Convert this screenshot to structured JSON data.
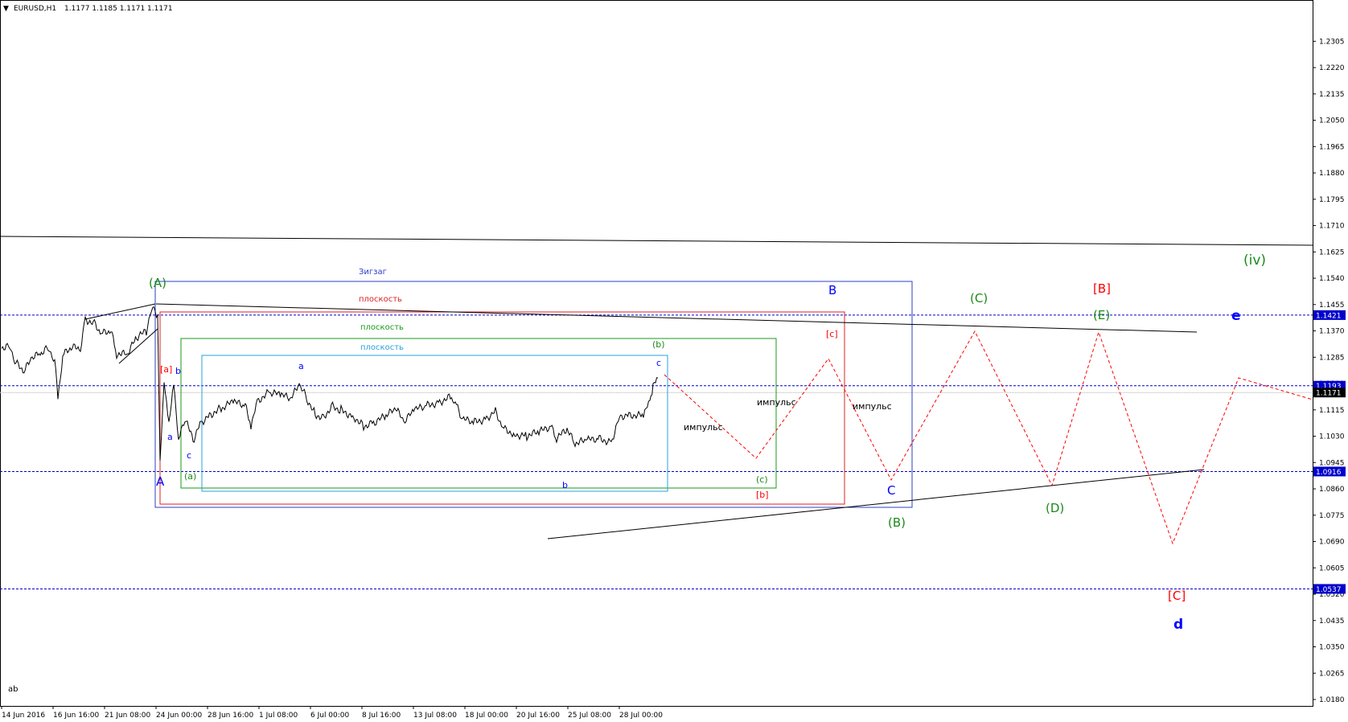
{
  "header": {
    "symbol": "EURUSD,H1",
    "ohlc": "1.1177 1.1185 1.1171 1.1171",
    "footer_text": "ab"
  },
  "chart_data": {
    "type": "line",
    "title": "EURUSD,H1  1.1177 1.1185 1.1171 1.1171",
    "ylim": [
      1.018,
      1.235
    ],
    "grid": false,
    "y_ticks": [
      "1.2305",
      "1.2220",
      "1.2135",
      "1.2050",
      "1.1965",
      "1.1880",
      "1.1795",
      "1.1710",
      "1.1625",
      "1.1540",
      "1.1455",
      "1.1370",
      "1.1285",
      "1.1200",
      "1.1115",
      "1.1030",
      "1.0945",
      "1.0860",
      "1.0775",
      "1.0690",
      "1.0605",
      "1.0520",
      "1.0435",
      "1.0350",
      "1.0265",
      "1.0180"
    ],
    "x_ticks": [
      "14 Jun 2016",
      "16 Jun 16:00",
      "21 Jun 08:00",
      "24 Jun 00:00",
      "28 Jun 16:00",
      "1 Jul 08:00",
      "6 Jul 00:00",
      "8 Jul 16:00",
      "13 Jul 08:00",
      "18 Jul 00:00",
      "20 Jul 16:00",
      "25 Jul 08:00",
      "28 Jul 00:00"
    ],
    "price_lines": [
      {
        "value": 1.1421,
        "label": "1.1421",
        "style": "dotted",
        "color": "#0000cc"
      },
      {
        "value": 1.1193,
        "label": "1.1193",
        "style": "dotted",
        "color": "#0000cc"
      },
      {
        "value": 1.0916,
        "label": "1.0916",
        "style": "dotted",
        "color": "#0000cc"
      },
      {
        "value": 1.0537,
        "label": "1.0537",
        "style": "dotted",
        "color": "#0000cc"
      },
      {
        "value": 1.1171,
        "label": "1.1171",
        "style": "solid-gray",
        "color": "#aaaaaa"
      }
    ],
    "boxes": [
      {
        "name": "Зигзаг",
        "color": "#2b3fc9"
      },
      {
        "name": "плоскость",
        "color": "#e02020"
      },
      {
        "name": "плоскость",
        "color": "#1a9a1a"
      },
      {
        "name": "плоскость",
        "color": "#2aa0e0"
      }
    ],
    "series": [
      {
        "color": "#000000",
        "style": "solid"
      },
      {
        "color": "#ff0000",
        "style": "dashed"
      }
    ]
  },
  "labels": {
    "box_zigzag": "Зигзаг",
    "box_flat_red": "плоскость",
    "box_flat_green": "плоскость",
    "box_flat_cyan": "плоскость",
    "A_green": "(A)",
    "A_blue": "A",
    "a_red": "[a]",
    "b_blue_small": "b",
    "a_blue_small": "a",
    "c_blue_small": "c",
    "a_green_small": "(a)",
    "a_top": "a",
    "b_bottom": "b",
    "c_top": "c",
    "b_green": "(b)",
    "c_green": "(c)",
    "b_red": "[b]",
    "c_red": "[c]",
    "B_blue": "B",
    "C_blue": "C",
    "impulse1": "импульс",
    "impulse2": "импульс",
    "impulse3": "импульс",
    "B_green": "(B)",
    "C_green": "(C)",
    "D_green": "(D)",
    "E_green": "(E)",
    "B_red": "[B]",
    "C_red": "[C]",
    "iv_green": "(iv)",
    "e_blue": "e",
    "d_blue": "d"
  },
  "colors": {
    "blue": "#0000ff",
    "red": "#ff0000",
    "green": "#1a8a1a",
    "box_blue": "#2b3fc9",
    "box_red": "#e02020",
    "box_green": "#1a9a1a",
    "box_cyan": "#2aa0e0"
  }
}
